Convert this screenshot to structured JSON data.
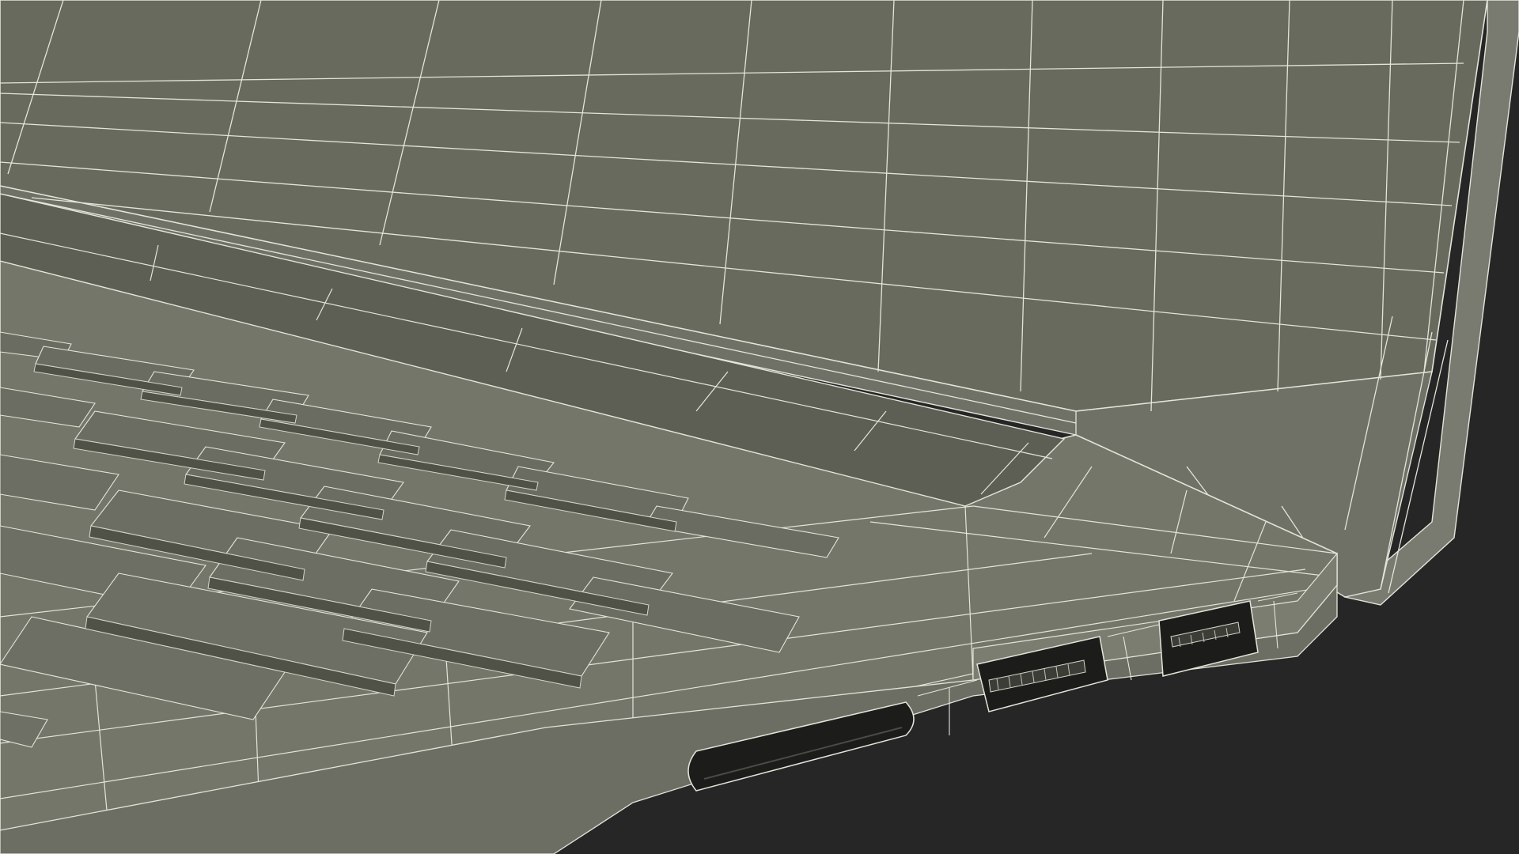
{
  "scene": {
    "subject": "laptop-wireframe-render",
    "colors": {
      "background": "#262626",
      "screen_fill": "#686a5e",
      "screen_fill_dark": "#5c5e53",
      "bezel_fill": "#75766b",
      "deck_fill": "#75776b",
      "deck_fill_light": "#7e8074",
      "key_top": "#6b6d62",
      "key_side": "#4e5047",
      "key_gap": "#3a3b34",
      "port_inner": "#1c1c1a",
      "wire": "#e4e4da",
      "wire_soft": "#d4d5ca"
    },
    "parts": [
      "display-screen",
      "display-bezel",
      "hinge",
      "keyboard-deck",
      "keyboard-keys",
      "sd-card-slot",
      "hdmi-port",
      "usb-port"
    ]
  }
}
